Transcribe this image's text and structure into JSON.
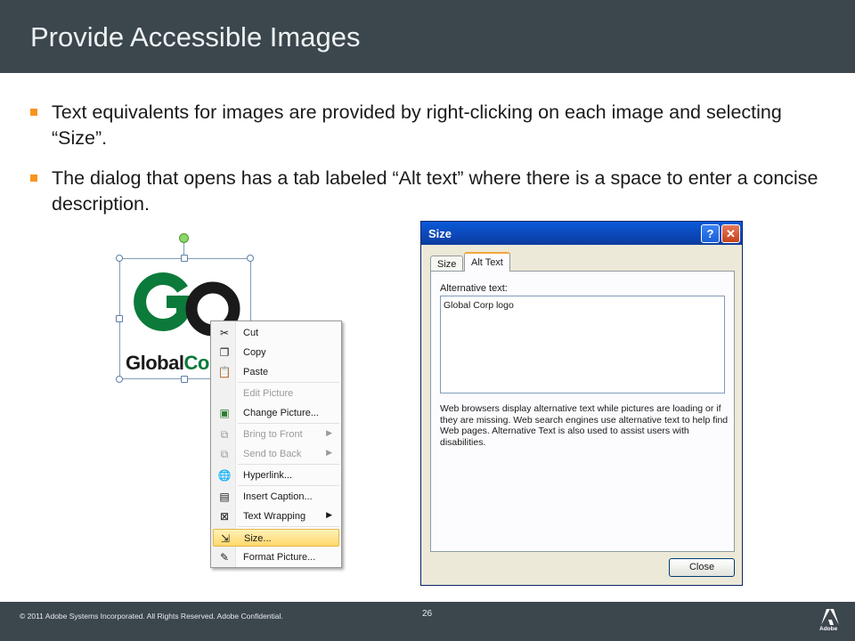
{
  "slide": {
    "title": "Provide Accessible Images",
    "bullets": [
      "Text equivalents for images are provided by right-clicking on each image and selecting “Size”.",
      "The dialog that opens has a tab labeled “Alt text” where there is a space to enter a concise description."
    ]
  },
  "logo": {
    "word_dark": "Global",
    "word_accent": "Co",
    "colors": {
      "green": "#0b7a3a",
      "dark": "#1a1a1a"
    }
  },
  "context_menu": {
    "items": [
      {
        "label": "Cut",
        "icon": "scissors-icon",
        "glyph": "✂",
        "disabled": false
      },
      {
        "label": "Copy",
        "icon": "copy-icon",
        "glyph": "❐",
        "disabled": false
      },
      {
        "label": "Paste",
        "icon": "paste-icon",
        "glyph": "📋",
        "disabled": false
      },
      {
        "label": "Edit Picture",
        "icon": "",
        "glyph": "",
        "disabled": true
      },
      {
        "label": "Change Picture...",
        "icon": "change-picture-icon",
        "glyph": "▣",
        "disabled": false
      },
      {
        "label": "Bring to Front",
        "icon": "bring-front-icon",
        "glyph": "⧉",
        "disabled": true,
        "submenu": true
      },
      {
        "label": "Send to Back",
        "icon": "send-back-icon",
        "glyph": "⧉",
        "disabled": true,
        "submenu": true
      },
      {
        "label": "Hyperlink...",
        "icon": "hyperlink-icon",
        "glyph": "🌐",
        "disabled": false
      },
      {
        "label": "Insert Caption...",
        "icon": "caption-icon",
        "glyph": "▤",
        "disabled": false
      },
      {
        "label": "Text Wrapping",
        "icon": "text-wrap-icon",
        "glyph": "⊠",
        "disabled": false,
        "submenu": true
      },
      {
        "label": "Size...",
        "icon": "size-icon",
        "glyph": "⇲",
        "disabled": false,
        "highlighted": true
      },
      {
        "label": "Format Picture...",
        "icon": "format-picture-icon",
        "glyph": "✎",
        "disabled": false
      }
    ]
  },
  "dialog": {
    "title": "Size",
    "help_glyph": "?",
    "close_glyph": "✕",
    "tabs": [
      "Size",
      "Alt Text"
    ],
    "active_tab": "Alt Text",
    "alt_label": "Alternative text:",
    "alt_value": "Global Corp logo",
    "description": "Web browsers display alternative text while pictures are loading or if they are missing.  Web search engines use alternative text to help find Web pages.  Alternative Text is also used to assist users with disabilities.",
    "close_button": "Close"
  },
  "footer": {
    "copyright": "© 2011 Adobe Systems Incorporated.  All Rights Reserved.  Adobe Confidential.",
    "page_number": "26",
    "brand": "Adobe"
  },
  "colors": {
    "bar": "#3c464d",
    "bullet_accent": "#f7941d",
    "dialog_title": "#0a5ad8"
  }
}
